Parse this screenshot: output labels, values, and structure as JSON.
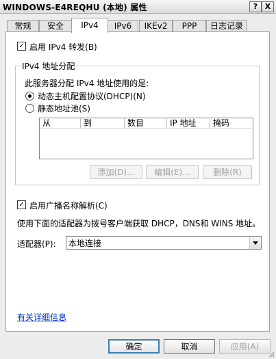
{
  "window": {
    "title": "WINDOWS-E4REQHU (本地) 属性",
    "help_glyph": "?",
    "close_glyph": "X"
  },
  "tabs": [
    {
      "label": "常规",
      "active": false
    },
    {
      "label": "安全",
      "active": false
    },
    {
      "label": "IPv4",
      "active": true
    },
    {
      "label": "IPv6",
      "active": false
    },
    {
      "label": "IKEv2",
      "active": false
    },
    {
      "label": "PPP",
      "active": false
    },
    {
      "label": "日志记录",
      "active": false
    }
  ],
  "ipv4": {
    "enable_forwarding_label": "启用 IPv4 转发(B)",
    "enable_forwarding_checked": true,
    "assignment_group_title": "IPv4 地址分配",
    "assignment_desc": "此服务器分配 IPv4 地址使用的是:",
    "dhcp_label": "动态主机配置协议(DHCP)(N)",
    "dhcp_selected": true,
    "static_pool_label": "静态地址池(S)",
    "static_pool_selected": false,
    "pool_columns": [
      "从",
      "到",
      "数目",
      "IP 地址",
      "掩码"
    ],
    "pool_rows": [],
    "add_button": "添加(D)...",
    "edit_button": "编辑(E)...",
    "remove_button": "删除(R)",
    "broadcast_label": "启用广播名称解析(C)",
    "broadcast_checked": true,
    "adapter_desc": "使用下面的适配器为拨号客户端获取 DHCP，DNS和 WINS 地址。",
    "adapter_label": "适配器(P):",
    "adapter_value": "本地连接",
    "more_info_link": "有关详细信息"
  },
  "footer": {
    "ok": "确定",
    "cancel": "取消",
    "apply": "应用(A)"
  },
  "colors": {
    "link": "#0033cc",
    "focus_border": "#3c7fb1",
    "disabled_text": "#a0a0a0"
  }
}
